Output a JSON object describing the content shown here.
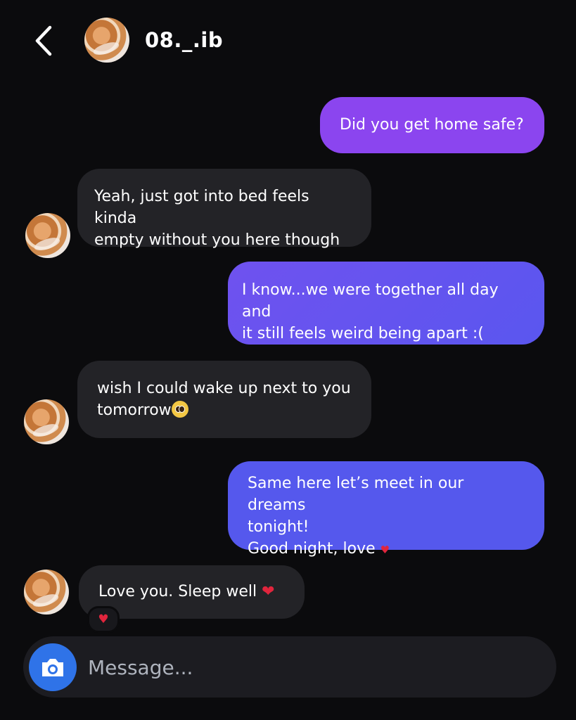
{
  "header": {
    "username": "08._.ib",
    "back_icon": "chevron-left-icon",
    "avatar": "orange-cat-avatar"
  },
  "messages": [
    {
      "direction": "outgoing",
      "text": "Did you get home safe?"
    },
    {
      "direction": "incoming",
      "line1": "Yeah, just got into bed feels kinda",
      "line2": "empty without you here though"
    },
    {
      "direction": "outgoing",
      "line1": "I know...we were together all day and",
      "line2": "it still feels weird being apart :("
    },
    {
      "direction": "incoming",
      "line1": "wish I could wake up next to you",
      "line2": "tomorrow",
      "emoji": "pleading-face-icon"
    },
    {
      "direction": "outgoing",
      "line1": "Same here let’s meet in our dreams",
      "line2": "tonight!",
      "line3": "Good night, love",
      "emoji": "red-heart-icon"
    },
    {
      "direction": "incoming",
      "text": "Love you. Sleep well",
      "emoji": "red-heart-icon",
      "reaction": "red-heart-icon"
    }
  ],
  "composer": {
    "placeholder": "Message...",
    "camera_icon": "camera-icon"
  },
  "colors": {
    "background": "#0b0b0d",
    "incoming_bubble": "#232327",
    "outgoing_purple": "#8b45ef",
    "outgoing_blue": "#5558ed",
    "camera_button": "#2f73e8",
    "heart": "#e1253d"
  }
}
